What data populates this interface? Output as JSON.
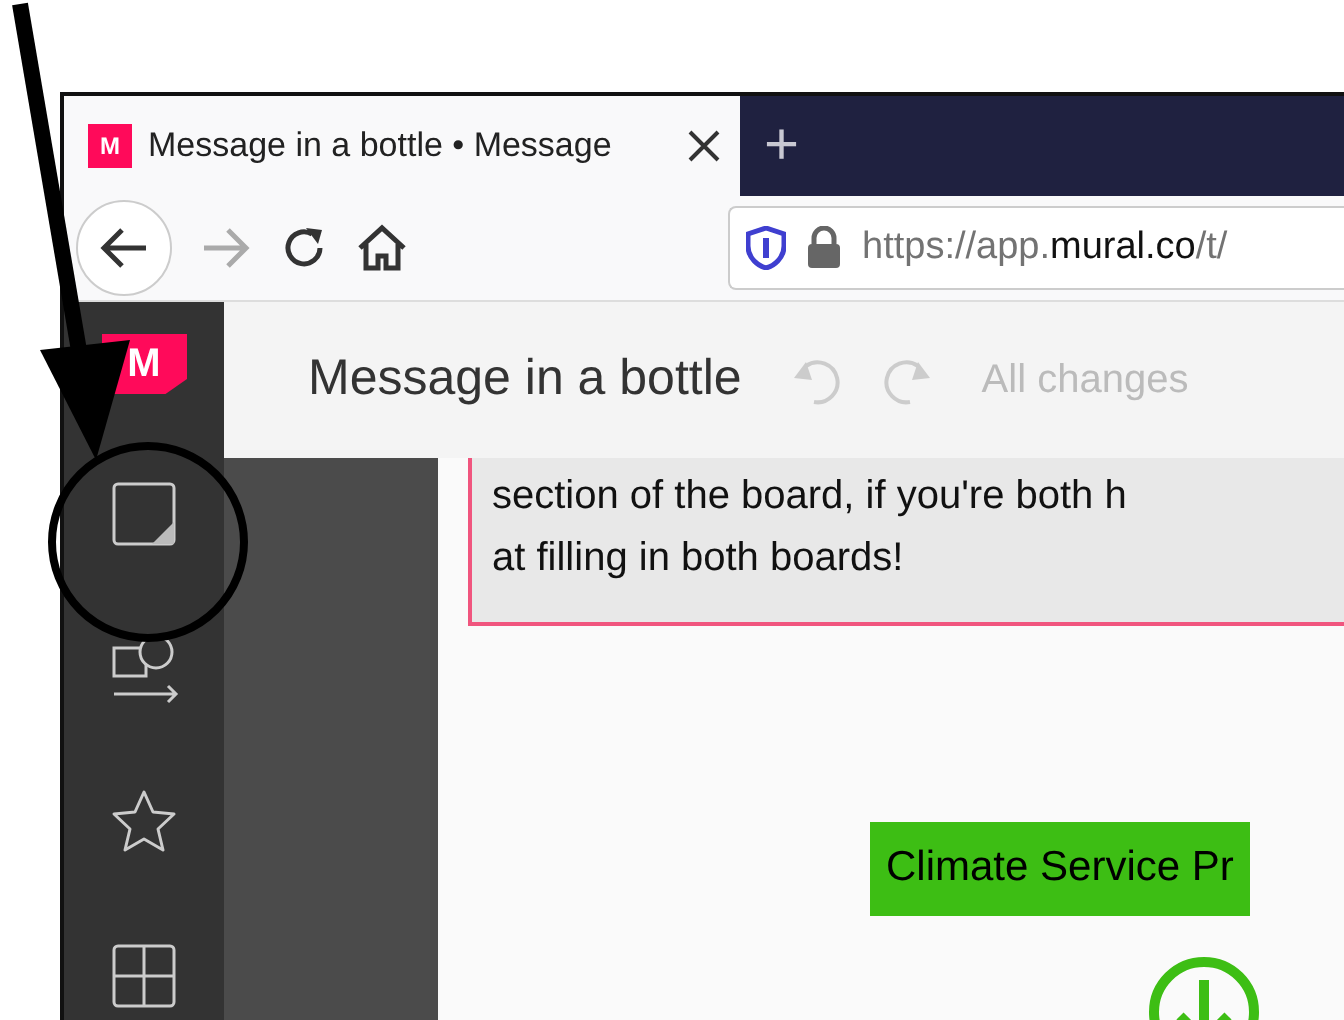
{
  "browser": {
    "tab": {
      "title": "Message in a bottle • Message",
      "selected": true
    },
    "tab_logo": "M",
    "new_tab": "+",
    "address": {
      "scheme_host": "https://app.",
      "domain": "mural.co",
      "path": "/t/"
    }
  },
  "app": {
    "logo": "M",
    "board_title": "Message in a bottle",
    "save_status": "All changes",
    "tools": [
      {
        "kind": "sticky"
      },
      {
        "kind": "shapes"
      },
      {
        "kind": "star"
      },
      {
        "kind": "grid"
      }
    ]
  },
  "canvas": {
    "note": {
      "lines": [
        "section of the board, if you're both h",
        "at filling in both boards!"
      ]
    },
    "label": {
      "text": "Climate Service Pr",
      "color": "#3dbe14"
    }
  }
}
